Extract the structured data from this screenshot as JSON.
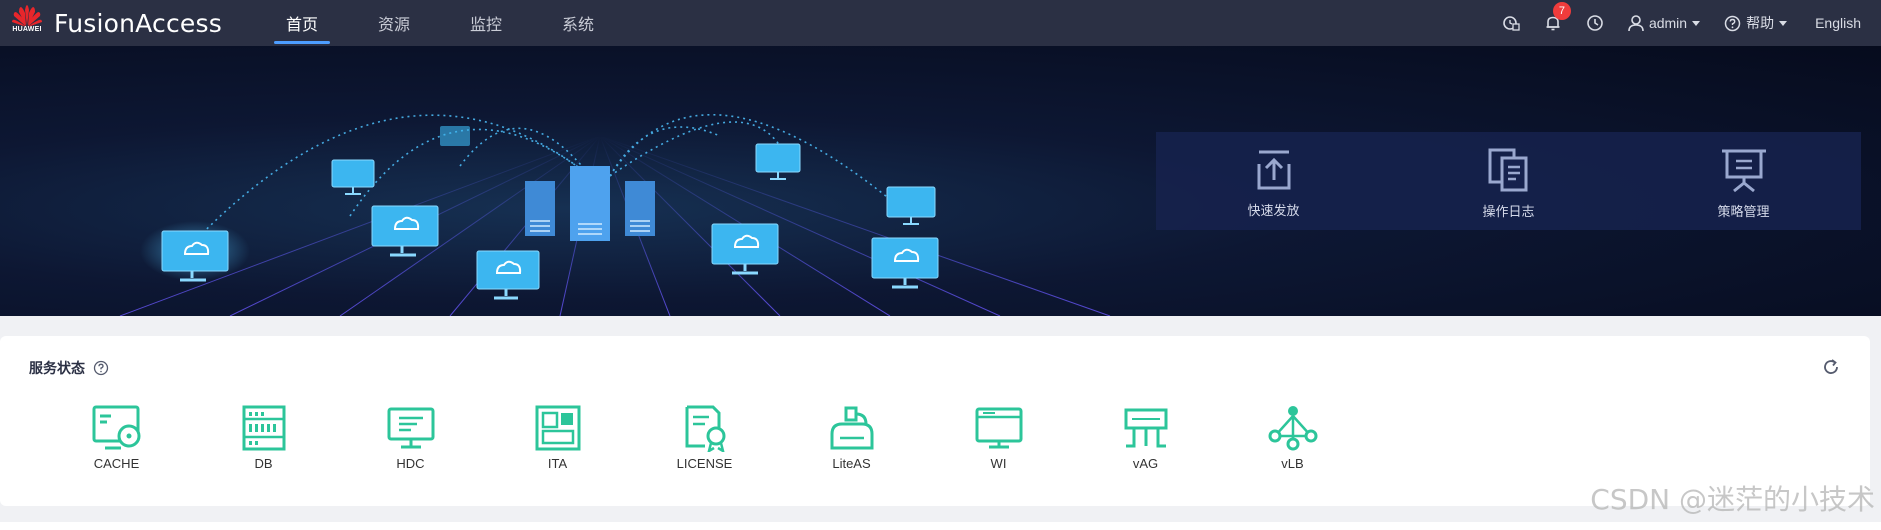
{
  "brand": {
    "company": "HUAWEI",
    "product": "FusionAccess"
  },
  "nav": {
    "items": [
      {
        "label": "首页",
        "active": true
      },
      {
        "label": "资源",
        "active": false
      },
      {
        "label": "监控",
        "active": false
      },
      {
        "label": "系统",
        "active": false
      }
    ]
  },
  "toolbar": {
    "notification_count": "7",
    "user": "admin",
    "help": "帮助",
    "language": "English"
  },
  "quick_actions": [
    {
      "label": "快速发放",
      "icon": "upload-icon"
    },
    {
      "label": "操作日志",
      "icon": "log-icon"
    },
    {
      "label": "策略管理",
      "icon": "policy-board-icon"
    }
  ],
  "service_status": {
    "title": "服务状态",
    "services": [
      {
        "label": "CACHE",
        "icon": "cache-icon"
      },
      {
        "label": "DB",
        "icon": "database-icon"
      },
      {
        "label": "HDC",
        "icon": "hdc-monitor-icon"
      },
      {
        "label": "ITA",
        "icon": "ita-grid-icon"
      },
      {
        "label": "LICENSE",
        "icon": "license-certificate-icon"
      },
      {
        "label": "LiteAS",
        "icon": "liteas-user-icon"
      },
      {
        "label": "WI",
        "icon": "wi-window-icon"
      },
      {
        "label": "vAG",
        "icon": "vag-gateway-icon"
      },
      {
        "label": "vLB",
        "icon": "vlb-network-icon"
      }
    ]
  },
  "colors": {
    "topbar": "#2b3044",
    "accent": "#4d9dff",
    "service_icon": "#2cc59a",
    "badge": "#f03c3c"
  },
  "watermark": "CSDN @迷茫的小技术"
}
